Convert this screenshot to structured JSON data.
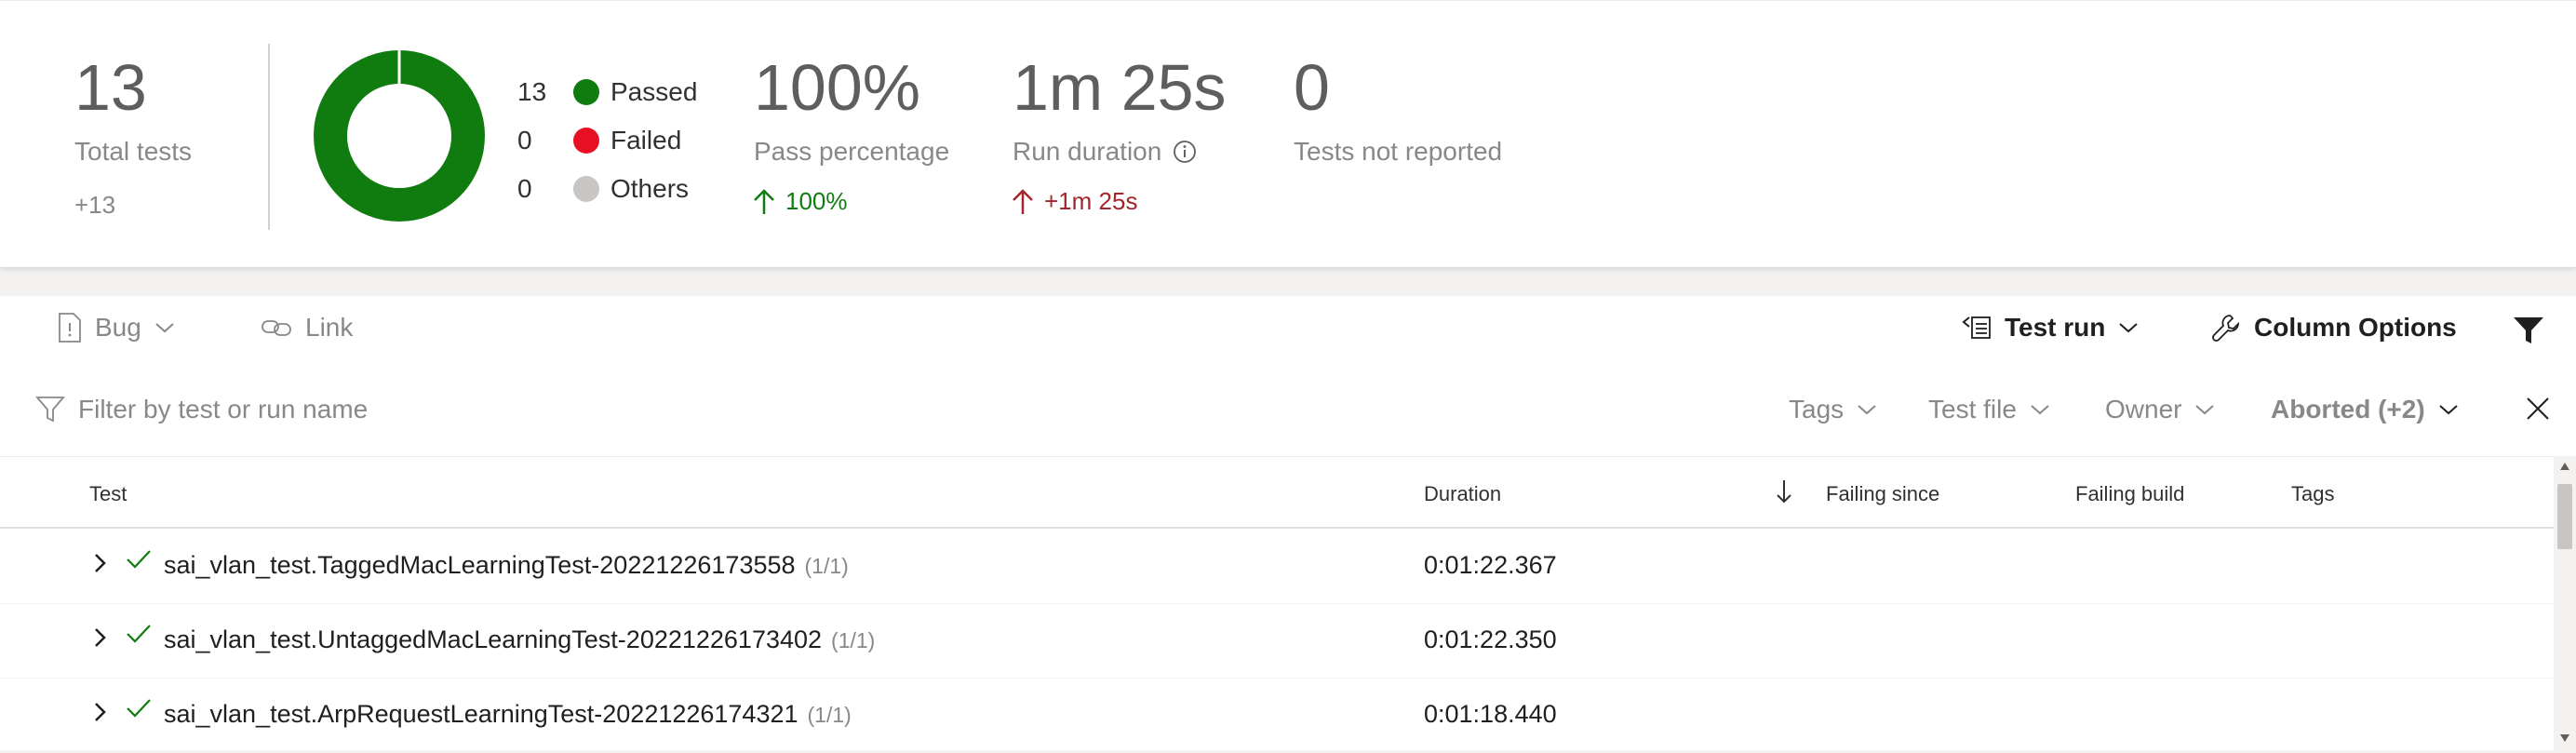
{
  "summary": {
    "total_tests": {
      "value": "13",
      "label": "Total tests",
      "delta": "+13"
    },
    "donut": {
      "passed_fraction": 1.0,
      "passed_color": "#107c10"
    },
    "legend": [
      {
        "count": "13",
        "label": "Passed",
        "color": "#107c10"
      },
      {
        "count": "0",
        "label": "Failed",
        "color": "#e81123"
      },
      {
        "count": "0",
        "label": "Others",
        "color": "#c8c6c4"
      }
    ],
    "pass_percentage": {
      "value": "100%",
      "label": "Pass percentage",
      "delta": "100%",
      "delta_color": "#107c10"
    },
    "run_duration": {
      "value": "1m 25s",
      "label": "Run duration",
      "delta": "+1m 25s",
      "delta_color": "#a4262c"
    },
    "not_reported": {
      "value": "0",
      "label": "Tests not reported"
    }
  },
  "toolbar": {
    "bug_label": "Bug",
    "link_label": "Link",
    "test_run_label": "Test run",
    "column_options_label": "Column Options"
  },
  "filter": {
    "placeholder": "Filter by test or run name",
    "tags_label": "Tags",
    "test_file_label": "Test file",
    "owner_label": "Owner",
    "outcome_label": "Aborted (+2)"
  },
  "table": {
    "columns": {
      "test": "Test",
      "duration": "Duration",
      "failing_since": "Failing since",
      "failing_build": "Failing build",
      "tags": "Tags"
    },
    "rows": [
      {
        "name": "sai_vlan_test.TaggedMacLearningTest-20221226173558",
        "count": "(1/1)",
        "duration": "0:01:22.367"
      },
      {
        "name": "sai_vlan_test.UntaggedMacLearningTest-20221226173402",
        "count": "(1/1)",
        "duration": "0:01:22.350"
      },
      {
        "name": "sai_vlan_test.ArpRequestLearningTest-20221226174321",
        "count": "(1/1)",
        "duration": "0:01:18.440"
      }
    ]
  }
}
